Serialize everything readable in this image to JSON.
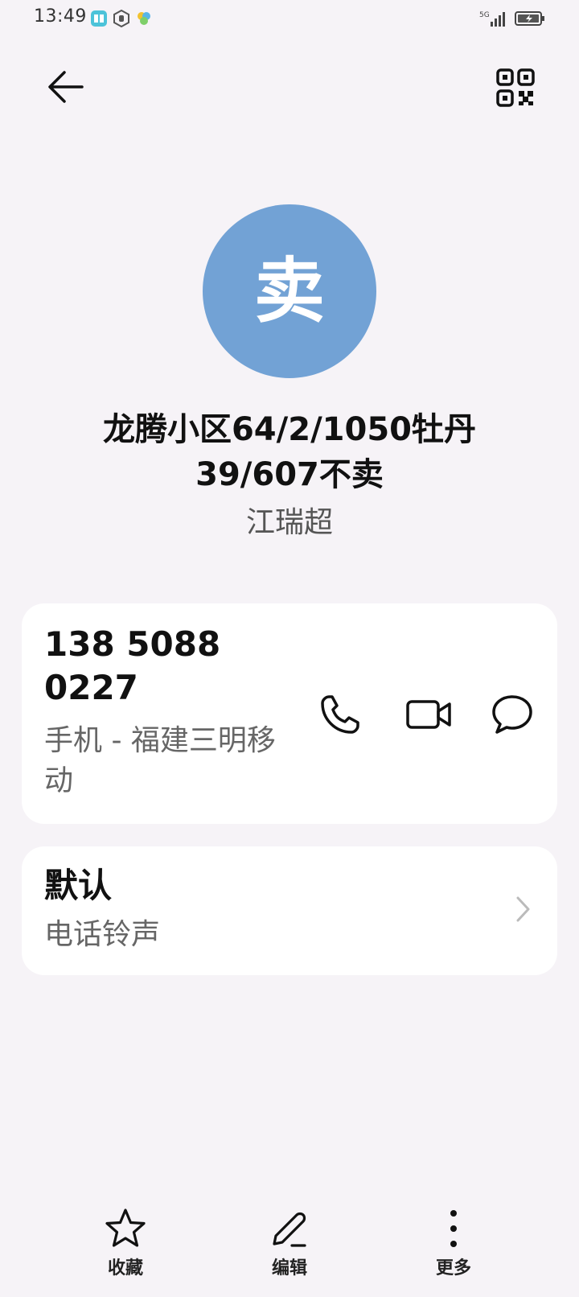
{
  "status": {
    "time": "13:49",
    "network": "5G"
  },
  "contact": {
    "avatar_char": "卖",
    "avatar_color": "#72a2d5",
    "name": "龙腾小区64/2/1050牡丹39/607不卖",
    "organization": "江瑞超"
  },
  "phone": {
    "number": "138 5088 0227",
    "type": "手机 - 福建三明移动"
  },
  "ringtone": {
    "value": "默认",
    "label": "电话铃声"
  },
  "bottom_bar": {
    "favorite": "收藏",
    "edit": "编辑",
    "more": "更多"
  }
}
